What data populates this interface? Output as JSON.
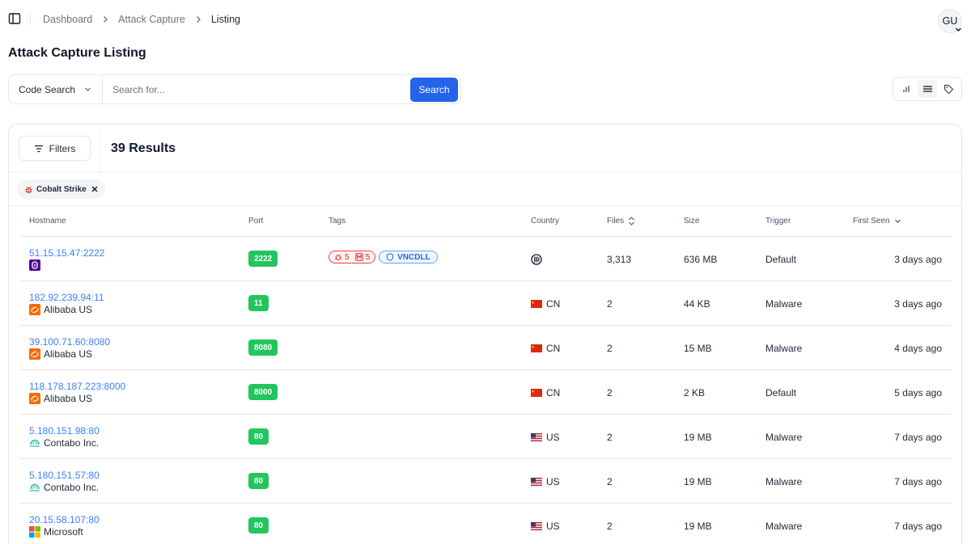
{
  "breadcrumb": {
    "items": [
      "Dashboard",
      "Attack Capture",
      "Listing"
    ]
  },
  "user": {
    "initials": "GU"
  },
  "page": {
    "title": "Attack Capture Listing"
  },
  "search": {
    "mode": "Code Search",
    "placeholder": "Search for...",
    "value": "",
    "button": "Search"
  },
  "view_options": [
    "chart-icon",
    "list-icon",
    "tag-icon"
  ],
  "filters": {
    "button": "Filters",
    "results": "39 Results",
    "active": [
      {
        "label": "Cobalt Strike",
        "icon": "bug-icon"
      }
    ]
  },
  "table": {
    "headers": {
      "hostname": "Hostname",
      "port": "Port",
      "tags": "Tags",
      "country": "Country",
      "files": "Files",
      "size": "Size",
      "trigger": "Trigger",
      "first_seen": "First Seen"
    },
    "rows": [
      {
        "host": "51.15.15.47:2222",
        "org": "",
        "org_icon": "scaleway-icon",
        "port": "2222",
        "tags": {
          "bug_count": "5",
          "memory_count": "5",
          "name": "VNCDLL"
        },
        "country": "",
        "country_icon": "unknown-globe-icon",
        "files": "3,313",
        "size": "636 MB",
        "trigger": "Default",
        "seen": "3 days ago"
      },
      {
        "host": "182.92.239.94:11",
        "org": "Alibaba US",
        "org_icon": "alibaba-icon",
        "port": "11",
        "country": "CN",
        "country_icon": "flag-cn-icon",
        "files": "2",
        "size": "44 KB",
        "trigger": "Malware",
        "seen": "3 days ago"
      },
      {
        "host": "39.100.71.60:8080",
        "org": "Alibaba US",
        "org_icon": "alibaba-icon",
        "port": "8080",
        "country": "CN",
        "country_icon": "flag-cn-icon",
        "files": "2",
        "size": "15 MB",
        "trigger": "Malware",
        "seen": "4 days ago"
      },
      {
        "host": "118.178.187.223:8000",
        "org": "Alibaba US",
        "org_icon": "alibaba-icon",
        "port": "8000",
        "country": "CN",
        "country_icon": "flag-cn-icon",
        "files": "2",
        "size": "2 KB",
        "trigger": "Default",
        "seen": "5 days ago"
      },
      {
        "host": "5.180.151.98:80",
        "org": "Contabo Inc.",
        "org_icon": "contabo-icon",
        "port": "80",
        "country": "US",
        "country_icon": "flag-us-icon",
        "files": "2",
        "size": "19 MB",
        "trigger": "Malware",
        "seen": "7 days ago"
      },
      {
        "host": "5.180.151.57:80",
        "org": "Contabo Inc.",
        "org_icon": "contabo-icon",
        "port": "80",
        "country": "US",
        "country_icon": "flag-us-icon",
        "files": "2",
        "size": "19 MB",
        "trigger": "Malware",
        "seen": "7 days ago"
      },
      {
        "host": "20.15.58.107:80",
        "org": "Microsoft",
        "org_icon": "microsoft-icon",
        "port": "80",
        "country": "US",
        "country_icon": "flag-us-icon",
        "files": "2",
        "size": "19 MB",
        "trigger": "Malware",
        "seen": "7 days ago"
      }
    ]
  },
  "colors": {
    "primary": "#2563eb",
    "link": "#3b82f6",
    "port_badge": "#22c55e",
    "tag_red": "#ef4444",
    "tag_blue": "#60a5fa"
  }
}
